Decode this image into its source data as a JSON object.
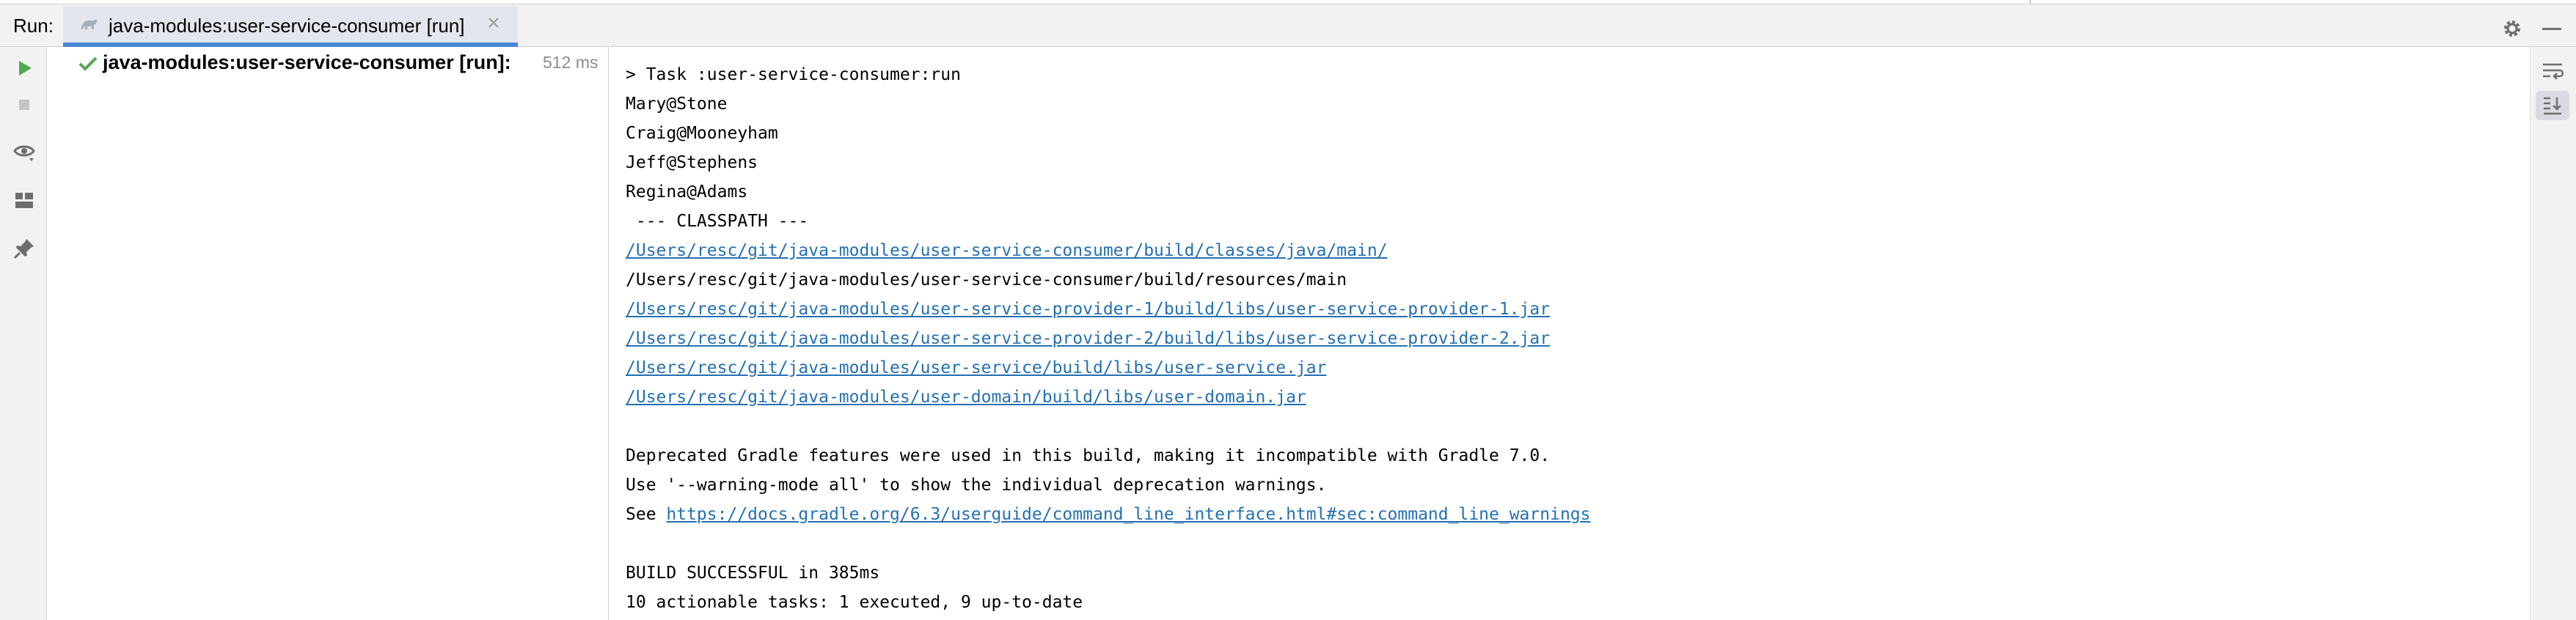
{
  "header": {
    "run_label": "Run:",
    "tab_title": "java-modules:user-service-consumer [run]"
  },
  "toolbar_icons": [
    "rerun-icon",
    "stop-icon",
    "eye-icon",
    "layout-icon",
    "pin-icon"
  ],
  "tree": {
    "item_label": "java-modules:user-service-consumer [run]:",
    "item_time": "512 ms"
  },
  "console": {
    "lines": [
      {
        "text": "> Task :user-service-consumer:run"
      },
      {
        "text": "Mary@Stone"
      },
      {
        "text": "Craig@Mooneyham"
      },
      {
        "text": "Jeff@Stephens"
      },
      {
        "text": "Regina@Adams"
      },
      {
        "text": " --- CLASSPATH ---"
      },
      {
        "text": "/Users/resc/git/java-modules/user-service-consumer/build/classes/java/main/"
      },
      {
        "text": "/Users/resc/git/java-modules/user-service-consumer/build/resources/main"
      },
      {
        "text": "/Users/resc/git/java-modules/user-service-provider-1/build/libs/user-service-provider-1.jar"
      },
      {
        "text": "/Users/resc/git/java-modules/user-service-provider-2/build/libs/user-service-provider-2.jar"
      },
      {
        "text": "/Users/resc/git/java-modules/user-service/build/libs/user-service.jar"
      },
      {
        "text": "/Users/resc/git/java-modules/user-domain/build/libs/user-domain.jar"
      },
      {
        "text": ""
      },
      {
        "text": "Deprecated Gradle features were used in this build, making it incompatible with Gradle 7.0."
      },
      {
        "text": "Use '--warning-mode all' to show the individual deprecation warnings."
      },
      {
        "prefix": "See ",
        "link": "https://docs.gradle.org/6.3/userguide/command_line_interface.html#sec:command_line_warnings"
      },
      {
        "text": ""
      },
      {
        "text": "BUILD SUCCESSFUL in 385ms"
      },
      {
        "text": "10 actionable tasks: 1 executed, 9 up-to-date"
      }
    ]
  },
  "colors": {
    "link": "#2470b3",
    "success_check": "#5ba35b",
    "rerun_green": "#4fa84d",
    "tab_underline": "#4b86d8"
  }
}
